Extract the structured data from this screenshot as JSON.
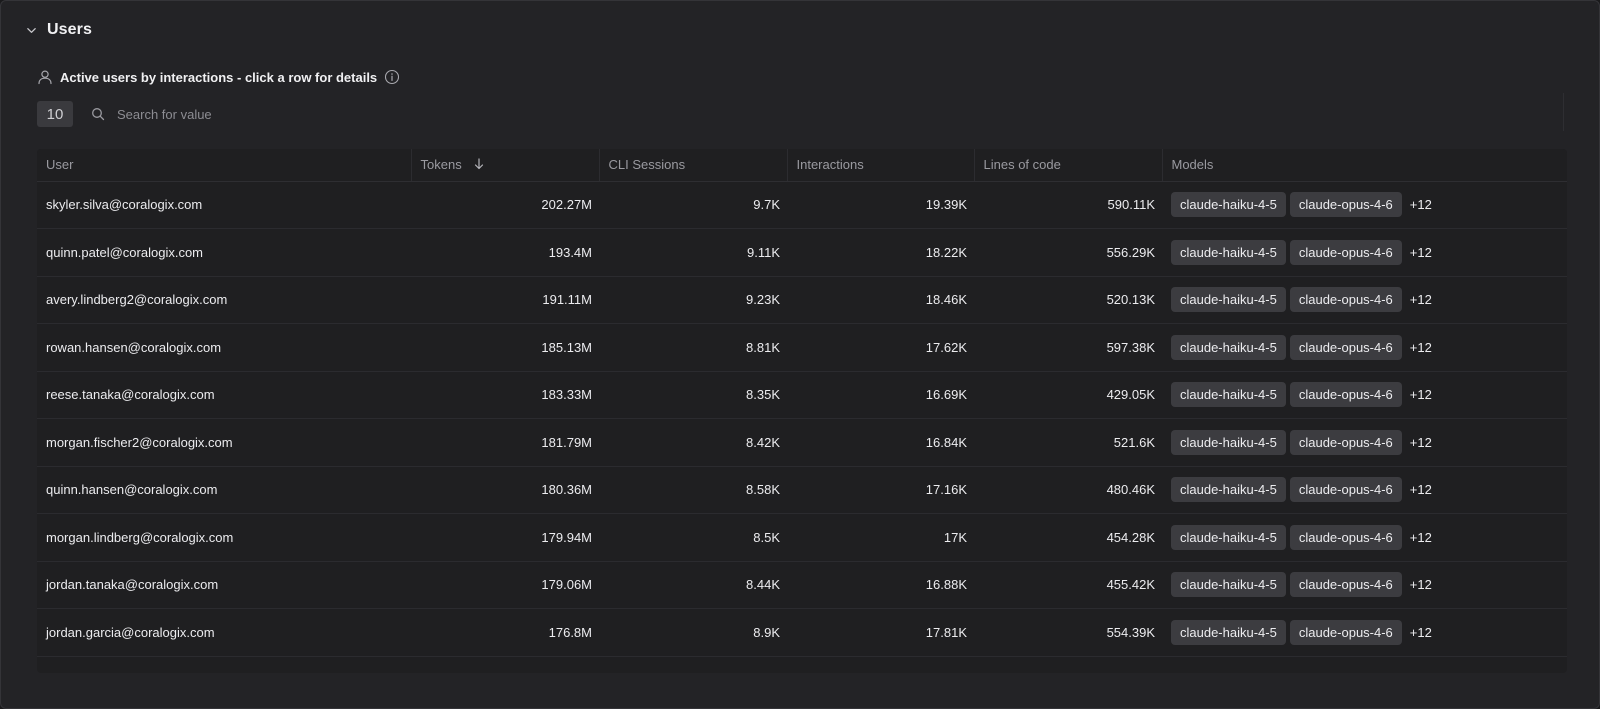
{
  "section": {
    "title": "Users"
  },
  "widget": {
    "title": "Active users by interactions - click a row for details",
    "page_size": "10",
    "search_placeholder": "Search for value"
  },
  "table": {
    "columns": [
      "User",
      "Tokens",
      "CLI Sessions",
      "Interactions",
      "Lines of code",
      "Models"
    ],
    "sorted_column": "Tokens",
    "sort_direction": "descending",
    "rows": [
      {
        "user": "skyler.silva@coralogix.com",
        "tokens": "202.27M",
        "cli_sessions": "9.7K",
        "interactions": "19.39K",
        "lines_of_code": "590.11K",
        "models": [
          "claude-haiku-4-5",
          "claude-opus-4-6"
        ],
        "more": "+12"
      },
      {
        "user": "quinn.patel@coralogix.com",
        "tokens": "193.4M",
        "cli_sessions": "9.11K",
        "interactions": "18.22K",
        "lines_of_code": "556.29K",
        "models": [
          "claude-haiku-4-5",
          "claude-opus-4-6"
        ],
        "more": "+12"
      },
      {
        "user": "avery.lindberg2@coralogix.com",
        "tokens": "191.11M",
        "cli_sessions": "9.23K",
        "interactions": "18.46K",
        "lines_of_code": "520.13K",
        "models": [
          "claude-haiku-4-5",
          "claude-opus-4-6"
        ],
        "more": "+12"
      },
      {
        "user": "rowan.hansen@coralogix.com",
        "tokens": "185.13M",
        "cli_sessions": "8.81K",
        "interactions": "17.62K",
        "lines_of_code": "597.38K",
        "models": [
          "claude-haiku-4-5",
          "claude-opus-4-6"
        ],
        "more": "+12"
      },
      {
        "user": "reese.tanaka@coralogix.com",
        "tokens": "183.33M",
        "cli_sessions": "8.35K",
        "interactions": "16.69K",
        "lines_of_code": "429.05K",
        "models": [
          "claude-haiku-4-5",
          "claude-opus-4-6"
        ],
        "more": "+12"
      },
      {
        "user": "morgan.fischer2@coralogix.com",
        "tokens": "181.79M",
        "cli_sessions": "8.42K",
        "interactions": "16.84K",
        "lines_of_code": "521.6K",
        "models": [
          "claude-haiku-4-5",
          "claude-opus-4-6"
        ],
        "more": "+12"
      },
      {
        "user": "quinn.hansen@coralogix.com",
        "tokens": "180.36M",
        "cli_sessions": "8.58K",
        "interactions": "17.16K",
        "lines_of_code": "480.46K",
        "models": [
          "claude-haiku-4-5",
          "claude-opus-4-6"
        ],
        "more": "+12"
      },
      {
        "user": "morgan.lindberg@coralogix.com",
        "tokens": "179.94M",
        "cli_sessions": "8.5K",
        "interactions": "17K",
        "lines_of_code": "454.28K",
        "models": [
          "claude-haiku-4-5",
          "claude-opus-4-6"
        ],
        "more": "+12"
      },
      {
        "user": "jordan.tanaka@coralogix.com",
        "tokens": "179.06M",
        "cli_sessions": "8.44K",
        "interactions": "16.88K",
        "lines_of_code": "455.42K",
        "models": [
          "claude-haiku-4-5",
          "claude-opus-4-6"
        ],
        "more": "+12"
      },
      {
        "user": "jordan.garcia@coralogix.com",
        "tokens": "176.8M",
        "cli_sessions": "8.9K",
        "interactions": "17.81K",
        "lines_of_code": "554.39K",
        "models": [
          "claude-haiku-4-5",
          "claude-opus-4-6"
        ],
        "more": "+12"
      }
    ]
  },
  "icons": {
    "collapse": "chevron-down-icon",
    "widget": "user-icon",
    "info": "info-icon",
    "search": "search-icon",
    "sort": "arrow-down-icon"
  },
  "colors": {
    "panel_bg": "#232326",
    "table_bg": "#1f1f21",
    "tag_bg": "#3c3c40",
    "header_text": "#9a9aa0",
    "text": "#ececef"
  }
}
